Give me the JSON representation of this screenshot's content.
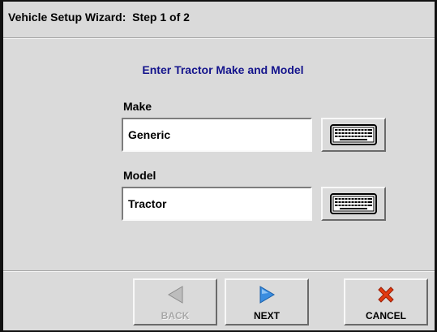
{
  "window": {
    "title": "Vehicle Setup Wizard:  Step 1 of 2"
  },
  "main": {
    "heading": "Enter Tractor Make and Model",
    "make": {
      "label": "Make",
      "value": "Generic"
    },
    "model": {
      "label": "Model",
      "value": "Tractor"
    }
  },
  "footer": {
    "back_label": "BACK",
    "next_label": "NEXT",
    "cancel_label": "CANCEL"
  },
  "colors": {
    "heading": "#14148c",
    "next_arrow": "#3a8de0",
    "cancel_x": "#e23a10",
    "disabled": "#a8a8a8"
  },
  "icons": {
    "keyboard": "keyboard-icon",
    "back": "left-arrow-icon",
    "next": "right-arrow-icon",
    "cancel": "x-icon"
  }
}
